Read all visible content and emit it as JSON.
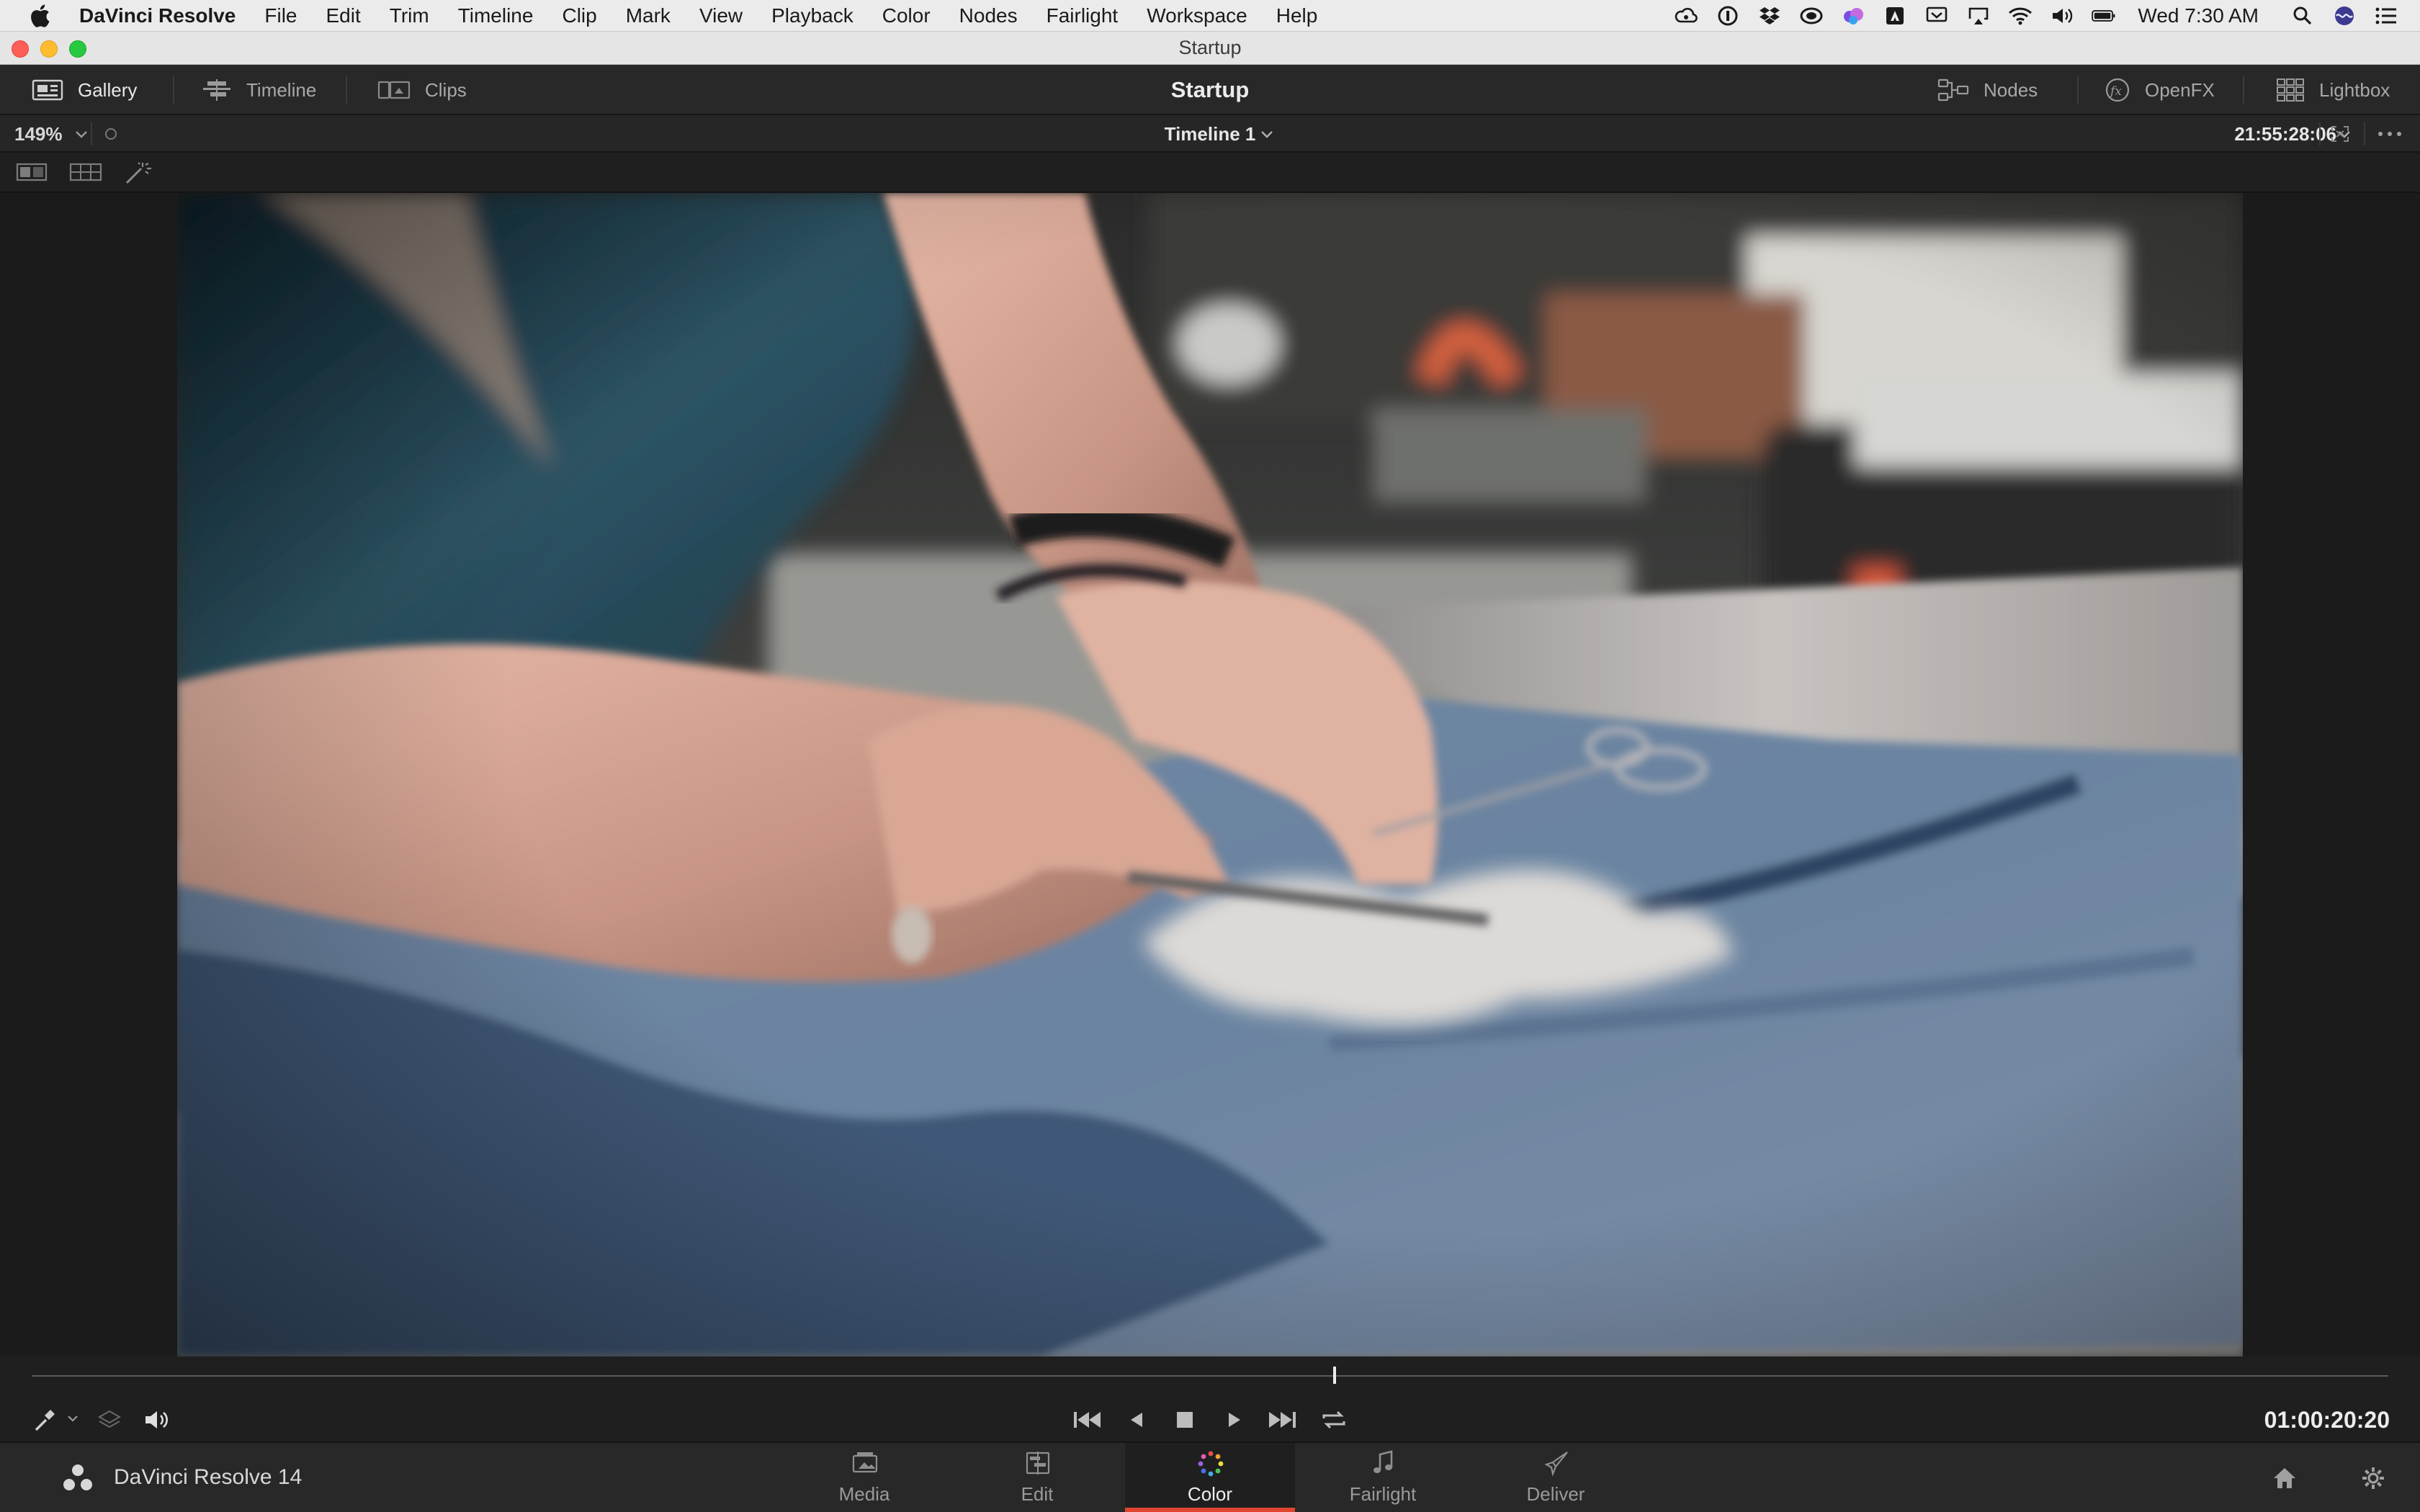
{
  "menubar": {
    "app_name": "DaVinci Resolve",
    "menus": [
      "File",
      "Edit",
      "Trim",
      "Timeline",
      "Clip",
      "Mark",
      "View",
      "Playback",
      "Color",
      "Nodes",
      "Fairlight",
      "Workspace",
      "Help"
    ],
    "status_icons": [
      "creative-cloud-icon",
      "1password-icon",
      "dropbox-icon",
      "cloud-sync-icon",
      "shared-drive-icon",
      "adobe-icon",
      "screen-icon",
      "airplay-icon",
      "wifi-icon",
      "volume-icon",
      "battery-icon"
    ],
    "clock": "Wed 7:30 AM"
  },
  "window": {
    "title": "Startup"
  },
  "header": {
    "gallery_label": "Gallery",
    "timeline_label": "Timeline",
    "clips_label": "Clips",
    "page_title": "Startup",
    "nodes_label": "Nodes",
    "openfx_label": "OpenFX",
    "lightbox_label": "Lightbox"
  },
  "viewer_toolbar": {
    "zoom": "149%",
    "timeline_name": "Timeline 1",
    "source_timecode": "21:55:28:06"
  },
  "transport": {
    "timecode": "01:00:20:20",
    "playhead_fraction": 0.553
  },
  "pagebar": {
    "product": "DaVinci Resolve 14",
    "tabs": [
      {
        "label": "Media",
        "active": false
      },
      {
        "label": "Edit",
        "active": false
      },
      {
        "label": "Color",
        "active": true
      },
      {
        "label": "Fairlight",
        "active": false
      },
      {
        "label": "Deliver",
        "active": false
      }
    ]
  },
  "colors": {
    "accent_red": "#e0452f",
    "panel": "#282829",
    "viewer_bg": "#1b1b1c"
  }
}
